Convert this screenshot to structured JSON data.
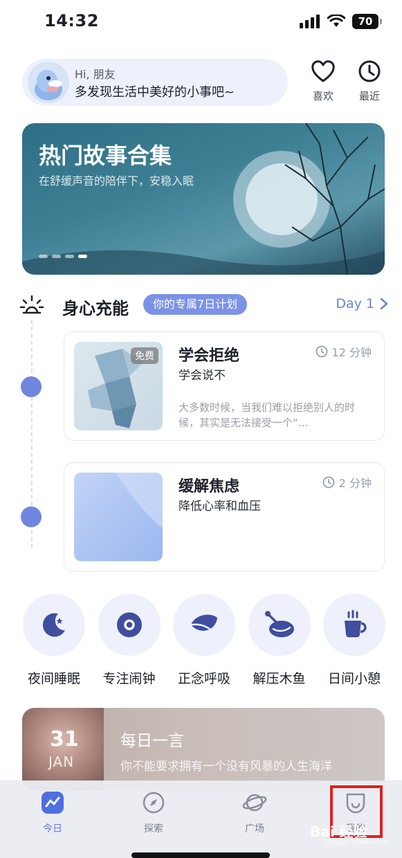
{
  "status_bar": {
    "time": "14:32",
    "battery": "70"
  },
  "greeting": {
    "hi": "Hi, 朋友",
    "message": "多发现生活中美好的小事吧~"
  },
  "top_actions": [
    {
      "label": "喜欢",
      "icon": "heart-icon"
    },
    {
      "label": "最近",
      "icon": "clock-icon"
    }
  ],
  "banner": {
    "title": "热门故事合集",
    "subtitle": "在舒缓声音的陪伴下，安稳入眠",
    "page_count": 4,
    "active_page": 4
  },
  "plan": {
    "title": "身心充能",
    "tag": "你的专属7日计划",
    "day": "Day 1",
    "items": [
      {
        "title": "学会拒绝",
        "subtitle": "学会说不",
        "duration": "12 分钟",
        "badge": "免费",
        "description": "大多数时候，当我们难以拒绝别人的时候，其实是无法接受一个“…"
      },
      {
        "title": "缓解焦虑",
        "subtitle": "降低心率和血压",
        "duration": "2 分钟"
      }
    ]
  },
  "shortcuts": [
    {
      "label": "夜间睡眠",
      "icon": "moon-icon"
    },
    {
      "label": "专注闹钟",
      "icon": "focus-icon"
    },
    {
      "label": "正念呼吸",
      "icon": "leaf-icon"
    },
    {
      "label": "解压木鱼",
      "icon": "wooden-fish-icon"
    },
    {
      "label": "日间小憩",
      "icon": "cup-icon"
    }
  ],
  "daily_quote": {
    "day": "31",
    "month": "JAN",
    "title": "每日一言",
    "text": "你不能要求拥有一个没有风暴的人生海洋"
  },
  "tab_bar": [
    {
      "label": "今日",
      "icon": "trend-icon",
      "active": true
    },
    {
      "label": "探索",
      "icon": "compass-icon",
      "active": false
    },
    {
      "label": "广场",
      "icon": "planet-icon",
      "active": false
    },
    {
      "label": "我的",
      "icon": "profile-icon",
      "active": false
    }
  ],
  "watermark": {
    "brand": "Bai 经验",
    "url": "jingyan.baidu.com"
  },
  "colors": {
    "accent": "#6f86de",
    "tag": "#7b92e6",
    "highlight": "#e01f1f"
  }
}
